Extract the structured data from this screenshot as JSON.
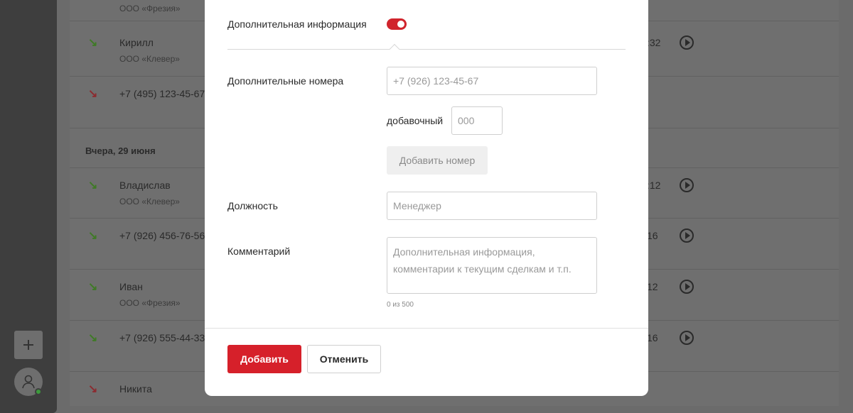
{
  "background": {
    "sidebar": {
      "add_icon": "plus-icon",
      "avatar_icon": "user-icon",
      "status": "online"
    },
    "calls": [
      {
        "direction": "incoming",
        "name": "",
        "company": "ООО «Фрезия»",
        "time": ""
      },
      {
        "direction": "incoming",
        "name": "Кирилл",
        "company": "ООО «Клевер»",
        "time": ":32"
      },
      {
        "direction": "missed",
        "name": "+7 (495) 123-45-67",
        "company": "",
        "time": ""
      },
      {
        "direction": "incoming",
        "name": "Владислав",
        "company": "ООО «Клевер»",
        "time": ":12"
      },
      {
        "direction": "incoming",
        "name": "+7 (926) 456-76-56",
        "company": "",
        "time": "16"
      },
      {
        "direction": "incoming",
        "name": "Иван",
        "company": "ООО «Фрезия»",
        "time": "12"
      },
      {
        "direction": "incoming",
        "name": "+7 (926) 555-44-33",
        "company": "",
        "time": "16"
      },
      {
        "direction": "missed",
        "name": "Никита",
        "company": "",
        "time": ""
      }
    ],
    "date_header": "Вчера, 29 июня"
  },
  "modal": {
    "extra_info_label": "Дополнительная информация",
    "extra_info_enabled": true,
    "extra_numbers_label": "Дополнительные номера",
    "phone_placeholder": "+7 (926) 123-45-67",
    "extension_label": "добавочный",
    "extension_placeholder": "000",
    "add_number_label": "Добавить номер",
    "position_label": "Должность",
    "position_placeholder": "Менеджер",
    "comment_label": "Комментарий",
    "comment_placeholder": "Дополнительная информация, комментарии к текущим сделкам и т.п.",
    "comment_counter": "0 из 500",
    "submit_label": "Добавить",
    "cancel_label": "Отменить",
    "accent_color": "#d6202a"
  }
}
